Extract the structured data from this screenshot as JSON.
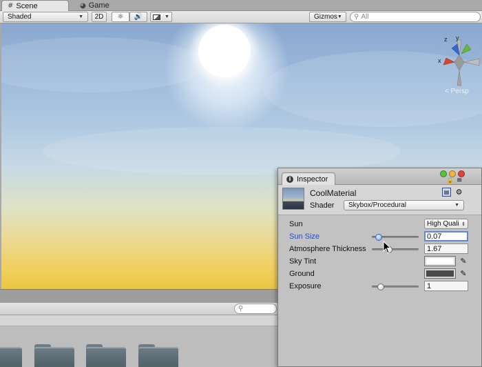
{
  "tabs": [
    {
      "label": "Scene",
      "icon": "grid-icon",
      "active": true
    },
    {
      "label": "Game",
      "icon": "pacman-icon",
      "active": false
    }
  ],
  "scene_toolbar": {
    "render_mode": "Shaded",
    "mode_2d": "2D",
    "gizmos_label": "Gizmos",
    "search_placeholder": "All"
  },
  "viewport": {
    "projection_label": "Persp",
    "gizmo_axes": {
      "x": "x",
      "y": "y",
      "z": "z"
    }
  },
  "inspector": {
    "tab_label": "Inspector",
    "material_name": "CoolMaterial",
    "shader_label": "Shader",
    "shader_value": "Skybox/Procedural",
    "properties": [
      {
        "label": "Sun",
        "kind": "dropdown",
        "value": "High Quali"
      },
      {
        "label": "Sun Size",
        "kind": "slider",
        "value": "0.07",
        "slider_fraction": 0.08,
        "focused": true
      },
      {
        "label": "Atmosphere Thickness",
        "kind": "slider",
        "value": "1.67",
        "slider_fraction": 0.35
      },
      {
        "label": "Sky Tint",
        "kind": "color",
        "color": "#ffffff"
      },
      {
        "label": "Ground",
        "kind": "color",
        "color": "#4a4a4a"
      },
      {
        "label": "Exposure",
        "kind": "slider",
        "value": "1",
        "slider_fraction": 0.14
      }
    ]
  },
  "colors": {
    "accent_focus": "#1e4fd6",
    "close_button": "#e0443a",
    "minimize_button": "#f0b43a",
    "zoom_button": "#5cc23e"
  }
}
